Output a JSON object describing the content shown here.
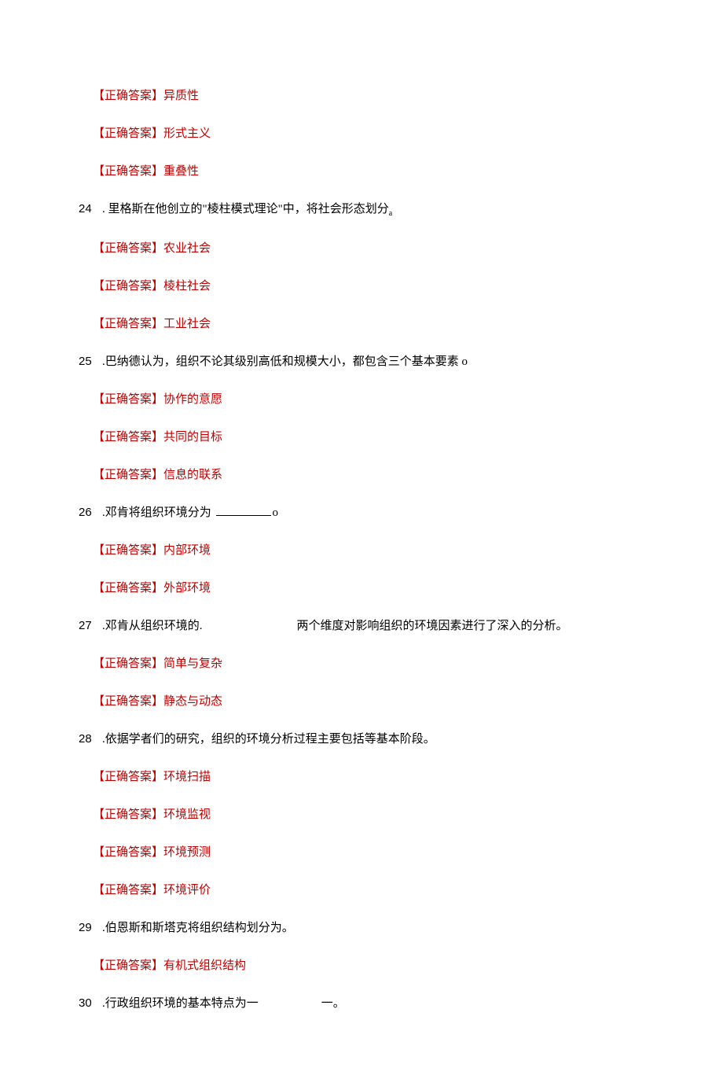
{
  "answers_pre": [
    "异质性",
    "形式主义",
    "重叠性"
  ],
  "answer_label": "【正确答案】",
  "questions": [
    {
      "num": "24",
      "text_before": ". 里格斯在他创立的\"棱柱模式理论\"中，将社会形态划分",
      "text_after": "",
      "suffix": " 。",
      "sub": true,
      "answers": [
        "农业社会",
        "棱柱社会",
        "工业社会"
      ]
    },
    {
      "num": "25",
      "text_before": ".巴纳德认为，组织不论其级别高低和规模大小，都包含三个基本要素 o",
      "text_after": "",
      "suffix": "",
      "answers": [
        "协作的意愿",
        "共同的目标",
        "信息的联系"
      ]
    },
    {
      "num": "26",
      "text_before": ".邓肯将组织环境分为 ",
      "blank": true,
      "text_after": "o",
      "suffix": "",
      "answers": [
        "内部环境",
        "外部环境"
      ]
    },
    {
      "num": "27",
      "text_before": ".邓肯从组织环境的.",
      "gap": true,
      "text_after": "两个维度对影响组织的环境因素进行了深入的分析。",
      "suffix": "",
      "answers": [
        "简单与复杂",
        "静态与动态"
      ]
    },
    {
      "num": "28",
      "text_before": ".依据学者们的研究，组织的环境分析过程主要包括等基本阶段。",
      "text_after": "",
      "suffix": "",
      "answers": [
        "环境扫描",
        "环境监视",
        "环境预测",
        "环境评价"
      ]
    },
    {
      "num": "29",
      "text_before": ".伯恩斯和斯塔克将组织结构划分为。",
      "text_after": "",
      "suffix": "",
      "answers": [
        "有机式组织结构"
      ]
    },
    {
      "num": "30",
      "text_before": ".行政组织环境的基本特点为一",
      "gap_small": true,
      "text_after": "一。",
      "suffix": "",
      "answers": []
    }
  ]
}
